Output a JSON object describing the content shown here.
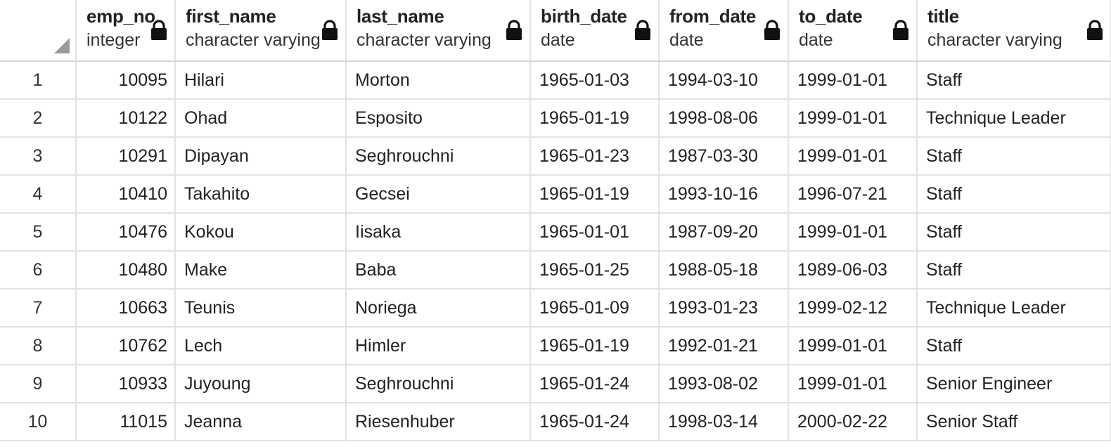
{
  "columns": [
    {
      "name": "emp_no",
      "type": "integer"
    },
    {
      "name": "first_name",
      "type": "character varying"
    },
    {
      "name": "last_name",
      "type": "character varying"
    },
    {
      "name": "birth_date",
      "type": "date"
    },
    {
      "name": "from_date",
      "type": "date"
    },
    {
      "name": "to_date",
      "type": "date"
    },
    {
      "name": "title",
      "type": "character varying"
    }
  ],
  "rows": [
    {
      "row": "1",
      "emp_no": "10095",
      "first_name": "Hilari",
      "last_name": "Morton",
      "birth_date": "1965-01-03",
      "from_date": "1994-03-10",
      "to_date": "1999-01-01",
      "title": "Staff"
    },
    {
      "row": "2",
      "emp_no": "10122",
      "first_name": "Ohad",
      "last_name": "Esposito",
      "birth_date": "1965-01-19",
      "from_date": "1998-08-06",
      "to_date": "1999-01-01",
      "title": "Technique Leader"
    },
    {
      "row": "3",
      "emp_no": "10291",
      "first_name": "Dipayan",
      "last_name": "Seghrouchni",
      "birth_date": "1965-01-23",
      "from_date": "1987-03-30",
      "to_date": "1999-01-01",
      "title": "Staff"
    },
    {
      "row": "4",
      "emp_no": "10410",
      "first_name": "Takahito",
      "last_name": "Gecsei",
      "birth_date": "1965-01-19",
      "from_date": "1993-10-16",
      "to_date": "1996-07-21",
      "title": "Staff"
    },
    {
      "row": "5",
      "emp_no": "10476",
      "first_name": "Kokou",
      "last_name": "Iisaka",
      "birth_date": "1965-01-01",
      "from_date": "1987-09-20",
      "to_date": "1999-01-01",
      "title": "Staff"
    },
    {
      "row": "6",
      "emp_no": "10480",
      "first_name": "Make",
      "last_name": "Baba",
      "birth_date": "1965-01-25",
      "from_date": "1988-05-18",
      "to_date": "1989-06-03",
      "title": "Staff"
    },
    {
      "row": "7",
      "emp_no": "10663",
      "first_name": "Teunis",
      "last_name": "Noriega",
      "birth_date": "1965-01-09",
      "from_date": "1993-01-23",
      "to_date": "1999-02-12",
      "title": "Technique Leader"
    },
    {
      "row": "8",
      "emp_no": "10762",
      "first_name": "Lech",
      "last_name": "Himler",
      "birth_date": "1965-01-19",
      "from_date": "1992-01-21",
      "to_date": "1999-01-01",
      "title": "Staff"
    },
    {
      "row": "9",
      "emp_no": "10933",
      "first_name": "Juyoung",
      "last_name": "Seghrouchni",
      "birth_date": "1965-01-24",
      "from_date": "1993-08-02",
      "to_date": "1999-01-01",
      "title": "Senior Engineer"
    },
    {
      "row": "10",
      "emp_no": "11015",
      "first_name": "Jeanna",
      "last_name": "Riesenhuber",
      "birth_date": "1965-01-24",
      "from_date": "1998-03-14",
      "to_date": "2000-02-22",
      "title": "Senior Staff"
    }
  ],
  "icons": {
    "column_lock": "lock-icon",
    "select_all": "select-all-triangle"
  }
}
